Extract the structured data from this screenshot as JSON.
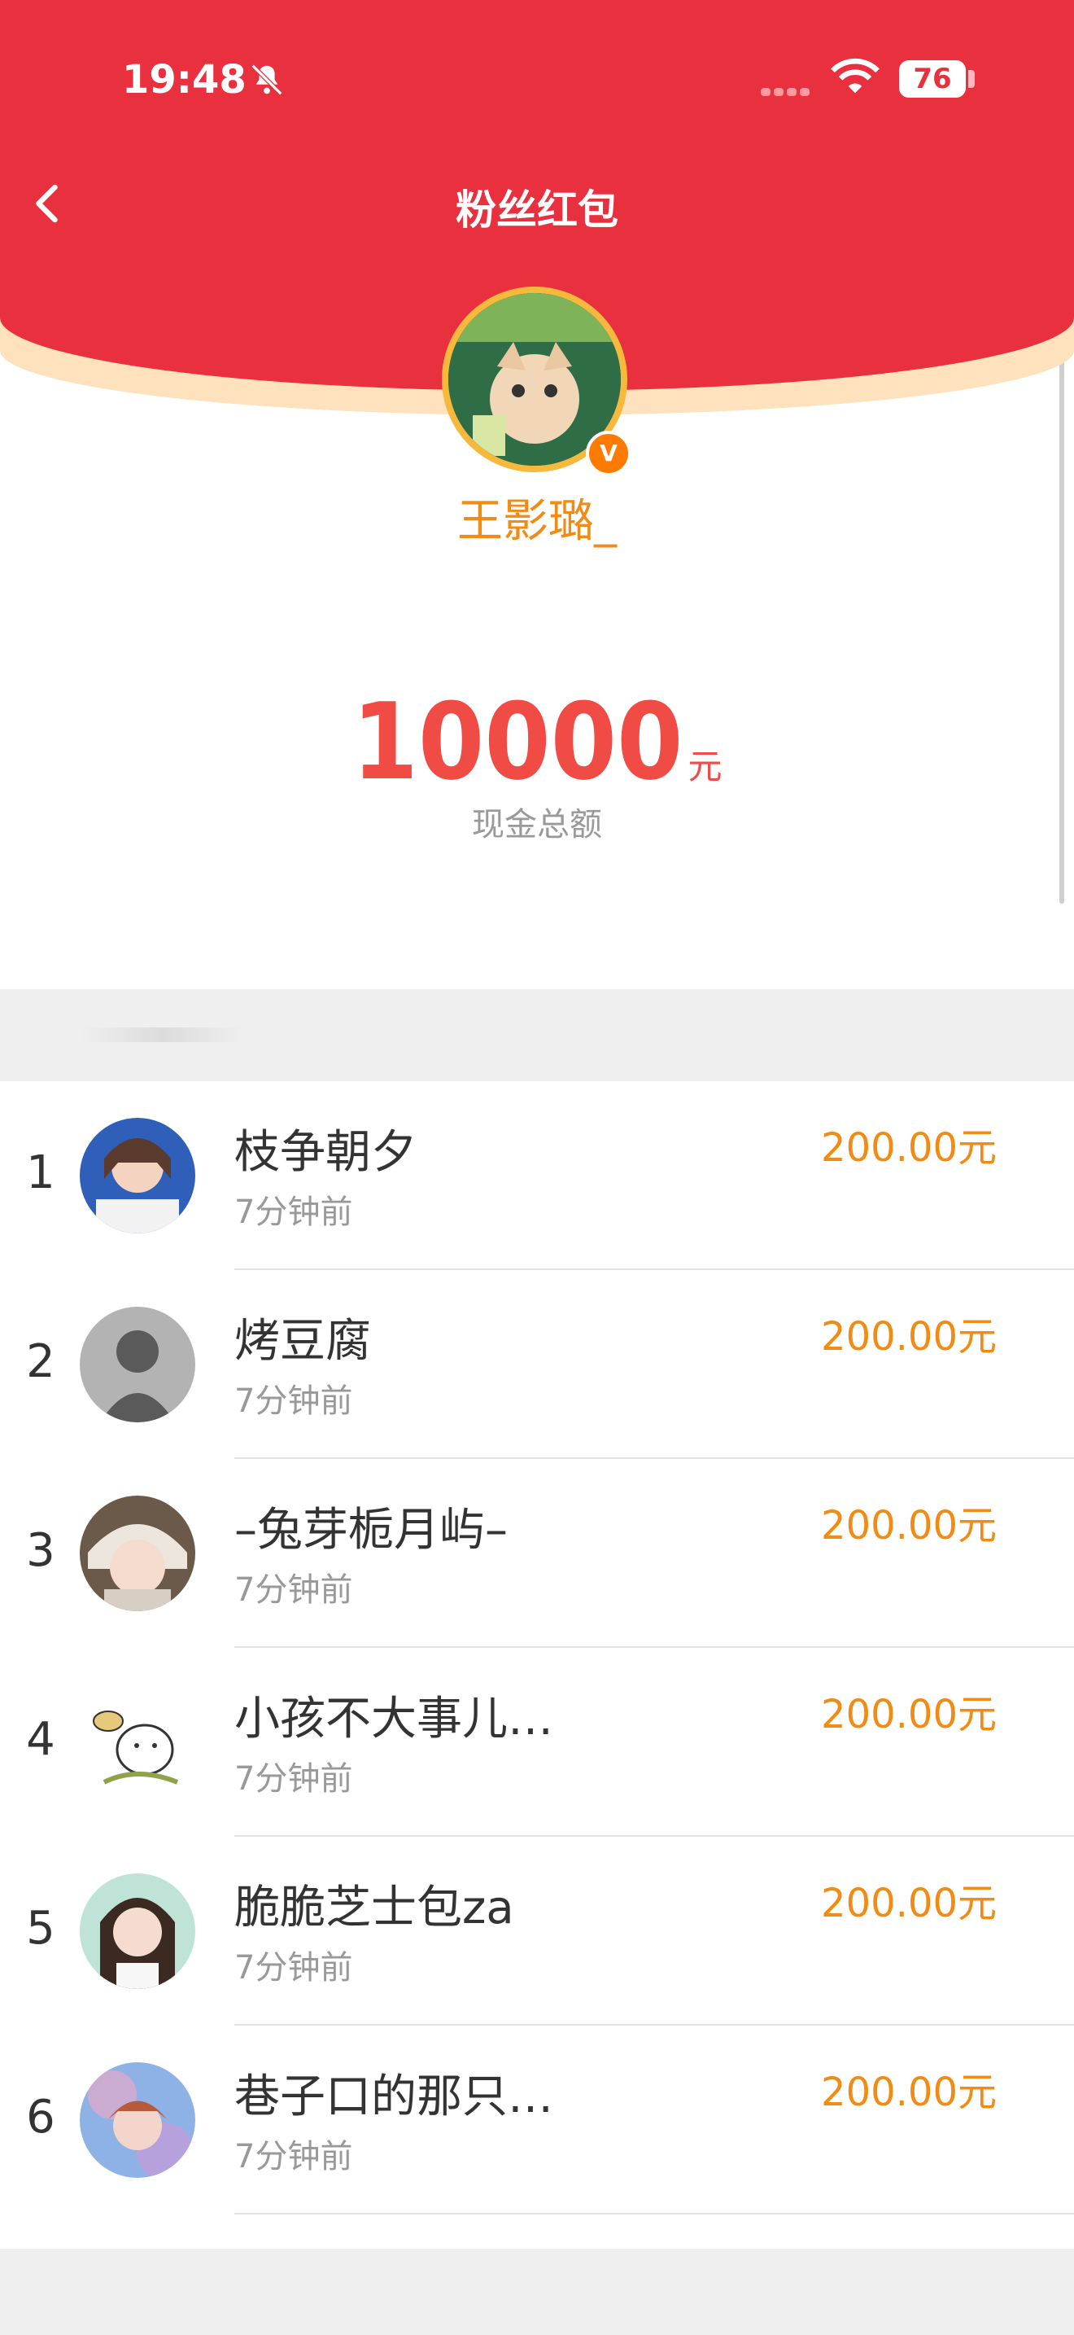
{
  "status": {
    "time": "19:48",
    "battery": "76"
  },
  "header": {
    "title": "粉丝红包"
  },
  "creator": {
    "name": "王影璐_"
  },
  "total": {
    "amount": "10000",
    "unit": "元",
    "label": "现金总额"
  },
  "list": [
    {
      "rank": "1",
      "name": "枝争朝夕",
      "time": "7分钟前",
      "amount": "200.00元"
    },
    {
      "rank": "2",
      "name": "烤豆腐",
      "time": "7分钟前",
      "amount": "200.00元"
    },
    {
      "rank": "3",
      "name": "–兔芽栀月屿–",
      "time": "7分钟前",
      "amount": "200.00元"
    },
    {
      "rank": "4",
      "name": "小孩不大事儿…",
      "time": "7分钟前",
      "amount": "200.00元"
    },
    {
      "rank": "5",
      "name": "脆脆芝士包za",
      "time": "7分钟前",
      "amount": "200.00元"
    },
    {
      "rank": "6",
      "name": "巷子口的那只…",
      "time": "7分钟前",
      "amount": "200.00元"
    }
  ],
  "colors": {
    "header_red": "#e8303e",
    "amount_red": "#f04b45",
    "orange": "#f08c15"
  }
}
